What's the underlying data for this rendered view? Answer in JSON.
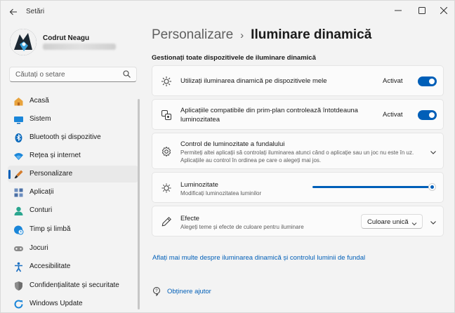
{
  "window": {
    "title": "Setări",
    "back_icon": "back-arrow-icon",
    "minimize_icon": "minimize-icon",
    "maximize_icon": "maximize-icon",
    "close_icon": "close-icon"
  },
  "profile": {
    "name": "Codrut Neagu",
    "avatar_icon": "user-avatar"
  },
  "search": {
    "placeholder": "Căutați o setare",
    "icon": "search-icon"
  },
  "sidebar": {
    "items": [
      {
        "label": "Acasă",
        "icon": "home-icon",
        "color": "#e8a33d",
        "active": false
      },
      {
        "label": "Sistem",
        "icon": "monitor-icon",
        "color": "#0f6cbd",
        "active": false
      },
      {
        "label": "Bluetooth și dispozitive",
        "icon": "bluetooth-icon",
        "color": "#0f6cbd",
        "active": false
      },
      {
        "label": "Rețea și internet",
        "icon": "wifi-icon",
        "color": "#1a86d9",
        "active": false
      },
      {
        "label": "Personalizare",
        "icon": "brush-icon",
        "color": "#d47b2a",
        "active": true
      },
      {
        "label": "Aplicații",
        "icon": "apps-icon",
        "color": "#4a6fa5",
        "active": false
      },
      {
        "label": "Conturi",
        "icon": "account-icon",
        "color": "#2aa68f",
        "active": false
      },
      {
        "label": "Timp și limbă",
        "icon": "globe-clock-icon",
        "color": "#1a86d9",
        "active": false
      },
      {
        "label": "Jocuri",
        "icon": "gamepad-icon",
        "color": "#6b6b6b",
        "active": false
      },
      {
        "label": "Accesibilitate",
        "icon": "accessibility-icon",
        "color": "#1a6fc2",
        "active": false
      },
      {
        "label": "Confidențialitate și securitate",
        "icon": "shield-icon",
        "color": "#7a7a7a",
        "active": false
      },
      {
        "label": "Windows Update",
        "icon": "update-icon",
        "color": "#1a86d9",
        "active": false
      }
    ]
  },
  "main": {
    "breadcrumb_parent": "Personalizare",
    "breadcrumb_separator": "›",
    "breadcrumb_current": "Iluminare dinamică",
    "section_heading": "Gestionați toate dispozitivele de iluminare dinamică",
    "cards": {
      "use_lighting": {
        "title": "Utilizați iluminarea dinamică pe dispozitivele mele",
        "toggle_label": "Activat",
        "toggle_on": true,
        "icon": "sun-burst-icon"
      },
      "foreground_apps": {
        "title_line1": "Aplicațiile compatibile din prim-plan controlează întotdeauna",
        "title_line2": "luminozitatea",
        "toggle_label": "Activat",
        "toggle_on": true,
        "icon": "app-control-icon"
      },
      "background_control": {
        "title": "Control de luminozitate a fundalului",
        "desc_line1": "Permiteți altei aplicații să controlați iluminarea atunci când o aplicație sau un joc nu este în uz.",
        "desc_line2": "Aplicațiile au control în ordinea pe care o alegeți mai jos.",
        "icon": "gear-icon"
      },
      "brightness": {
        "title": "Luminozitate",
        "desc": "Modificați luminozitatea luminilor",
        "value_percent": 100,
        "icon": "brightness-icon"
      },
      "effects": {
        "title": "Efecte",
        "desc": "Alegeți teme și efecte de culoare pentru iluminare",
        "dropdown_value": "Culoare unică",
        "icon": "pen-icon"
      }
    },
    "learn_more_link": "Aflați mai multe despre iluminarea dinamică și controlul luminii de fundal",
    "help_link": "Obținere ajutor",
    "accent_color": "#005fb8"
  }
}
